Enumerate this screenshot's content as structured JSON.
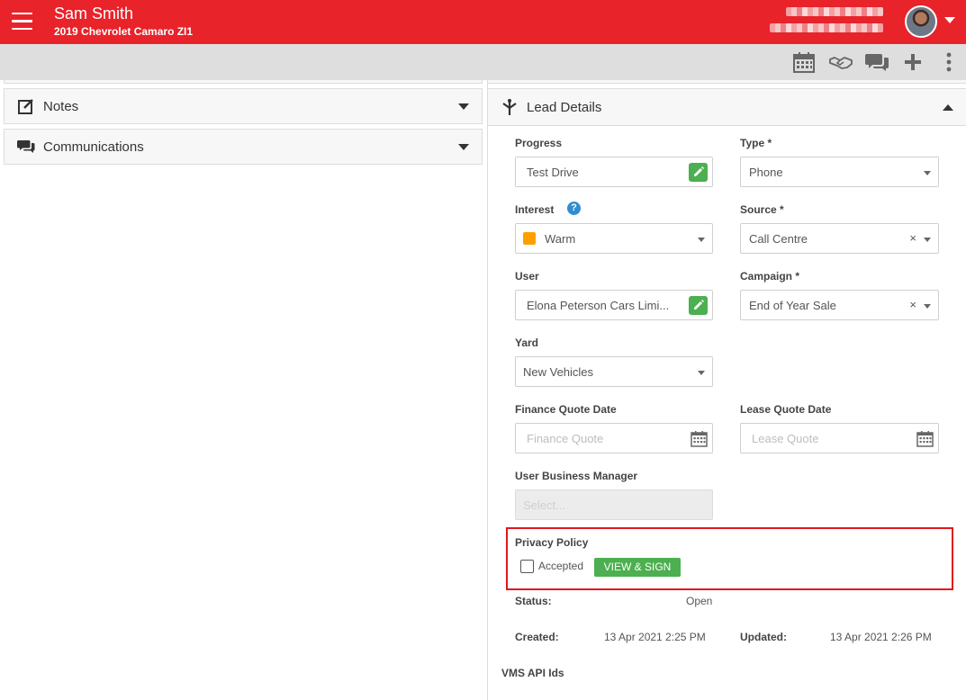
{
  "header": {
    "customer_name": "Sam Smith",
    "vehicle": "2019 Chevrolet Camaro ZI1",
    "brand_color": "#e8232a"
  },
  "toolbar": {
    "icons": [
      "calendar-icon",
      "handshake-icon",
      "chat-icon",
      "plus-icon",
      "more-vertical-icon"
    ]
  },
  "left_panels": {
    "notes": "Notes",
    "communications": "Communications"
  },
  "lead_details": {
    "title": "Lead Details",
    "progress": {
      "label": "Progress",
      "value": "Test Drive"
    },
    "type": {
      "label": "Type *",
      "value": "Phone"
    },
    "interest": {
      "label": "Interest",
      "value": "Warm",
      "help": "?"
    },
    "source": {
      "label": "Source *",
      "value": "Call Centre",
      "clear": "×"
    },
    "user": {
      "label": "User",
      "value": "Elona Peterson Cars Limi..."
    },
    "campaign": {
      "label": "Campaign *",
      "value": "End of Year Sale",
      "clear": "×"
    },
    "yard": {
      "label": "Yard",
      "value": "New Vehicles"
    },
    "finance_quote_date": {
      "label": "Finance Quote Date",
      "placeholder": "Finance Quote"
    },
    "lease_quote_date": {
      "label": "Lease Quote Date",
      "placeholder": "Lease Quote"
    },
    "user_business_manager": {
      "label": "User Business Manager",
      "placeholder": "Select..."
    },
    "privacy_policy": {
      "label": "Privacy Policy",
      "checkbox_label": "Accepted",
      "button": "VIEW & SIGN"
    },
    "status": {
      "label": "Status:",
      "value": "Open"
    },
    "created": {
      "label": "Created:",
      "value": "13 Apr 2021 2:25 PM"
    },
    "updated": {
      "label": "Updated:",
      "value": "13 Apr 2021 2:26 PM"
    },
    "vms_api_ids": "VMS API Ids"
  }
}
